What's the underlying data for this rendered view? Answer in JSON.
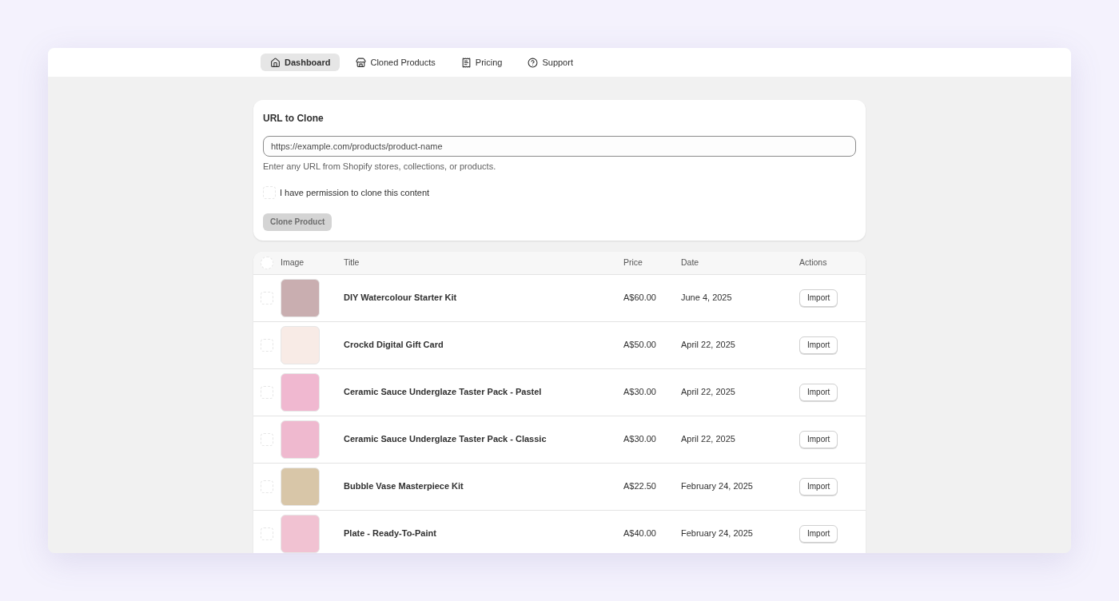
{
  "nav": [
    {
      "label": "Dashboard",
      "selected": true
    },
    {
      "label": "Cloned Products",
      "selected": false
    },
    {
      "label": "Pricing",
      "selected": false
    },
    {
      "label": "Support",
      "selected": false
    }
  ],
  "clone_form": {
    "title": "URL to Clone",
    "url_field": {
      "placeholder": "https://example.com/products/product-name"
    },
    "help_text": "Enter any URL from Shopify stores, collections, or products.",
    "permission": {
      "label": "I have permission to clone this content",
      "checked": false
    },
    "button": {
      "label": "Clone Product",
      "disabled": true
    }
  },
  "table": {
    "select_all": {
      "checked": false
    },
    "columns": [
      "Image",
      "Title",
      "Price",
      "Date",
      "Actions"
    ],
    "rows": [
      {
        "title": "DIY Watercolour Starter Kit",
        "price": "A$60.00",
        "date": "June 4, 2025",
        "action": "Import",
        "checked": false
      },
      {
        "title": "Crockd Digital Gift Card",
        "price": "A$50.00",
        "date": "April 22, 2025",
        "action": "Import",
        "checked": false
      },
      {
        "title": "Ceramic Sauce Underglaze Taster Pack - Pastel",
        "price": "A$30.00",
        "date": "April 22, 2025",
        "action": "Import",
        "checked": false
      },
      {
        "title": "Ceramic Sauce Underglaze Taster Pack - Classic",
        "price": "A$30.00",
        "date": "April 22, 2025",
        "action": "Import",
        "checked": false
      },
      {
        "title": "Bubble Vase Masterpiece Kit",
        "price": "A$22.50",
        "date": "February 24, 2025",
        "action": "Import",
        "checked": false
      },
      {
        "title": "Plate - Ready-To-Paint",
        "price": "A$40.00",
        "date": "February 24, 2025",
        "action": "Import",
        "checked": false
      }
    ]
  }
}
